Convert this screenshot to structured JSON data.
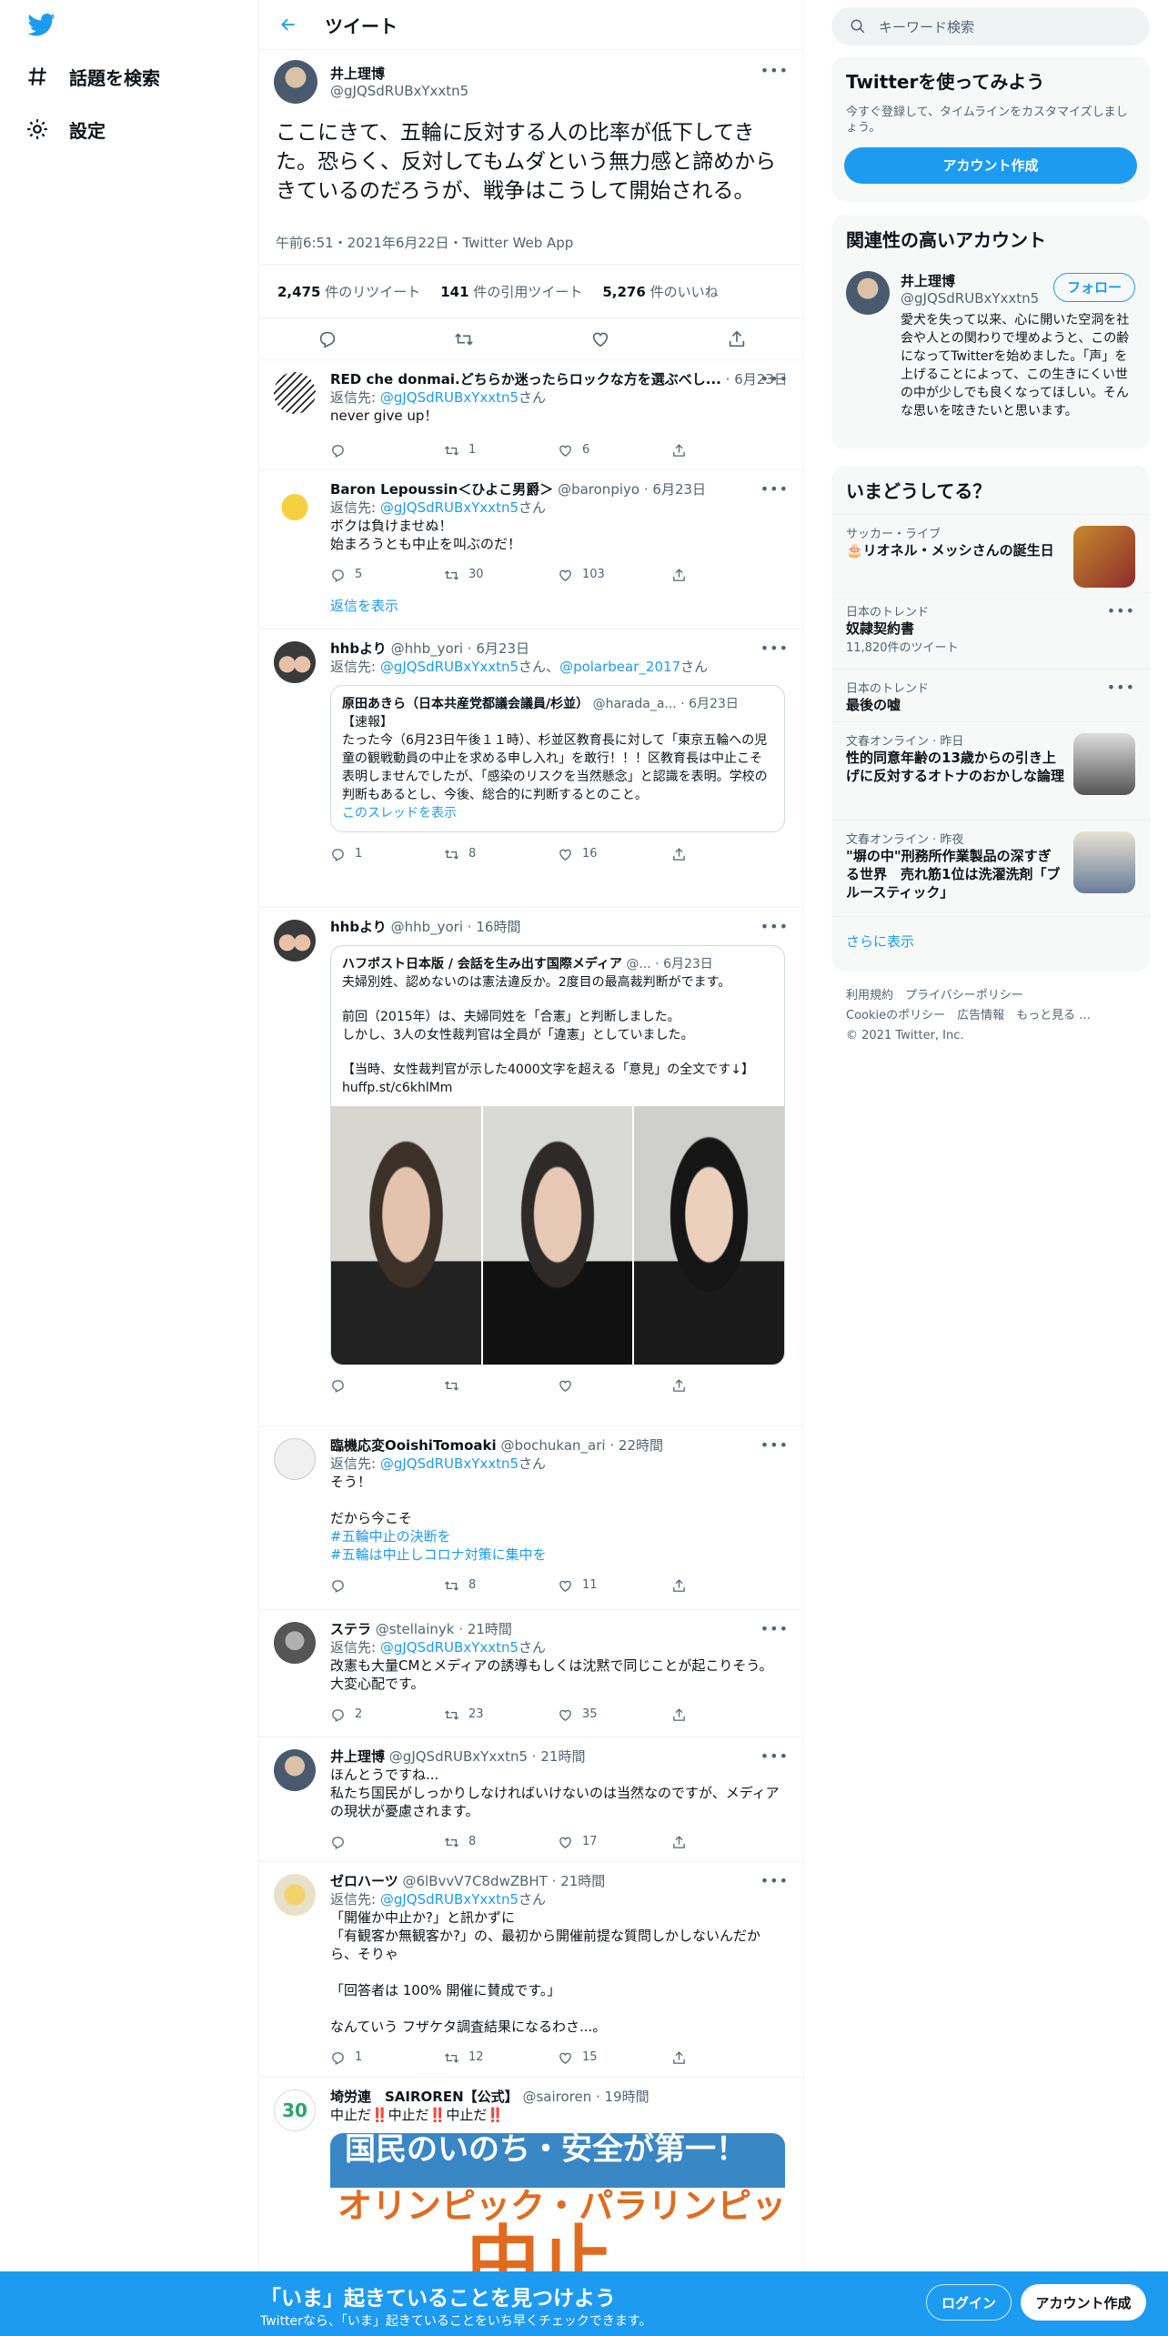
{
  "nav": {
    "explore": "話題を検索",
    "settings": "設定"
  },
  "header": {
    "title": "ツイート"
  },
  "main_tweet": {
    "name": "井上理博",
    "handle": "@gJQSdRUBxYxxtn5",
    "text": "ここにきて、五輪に反対する人の比率が低下してきた。恐らく、反対してもムダという無力感と諦めからきているのだろうが、戦争はこうして開始される。",
    "meta": "午前6:51・2021年6月22日・Twitter Web App",
    "retweets": "2,475",
    "retweets_label": "件のリツイート",
    "quotes": "141",
    "quotes_label": "件の引用ツイート",
    "likes": "5,276",
    "likes_label": "件のいいね"
  },
  "replies": [
    {
      "name": "RED che donmai.どちらか迷ったらロックな方を選ぶべし...",
      "handle": "",
      "time": "6月23日",
      "reply_to_label": "返信先: ",
      "reply_to": "@gJQSdRUBxYxxtn5",
      "reply_suffix": "さん",
      "text": "never give up！",
      "reply_count": "",
      "rt_count": "1",
      "like_count": "6"
    },
    {
      "name": "Baron Lepoussin＜ひよこ男爵＞",
      "handle": "@baronpiyo",
      "time": "6月23日",
      "reply_to_label": "返信先: ",
      "reply_to": "@gJQSdRUBxYxxtn5",
      "reply_suffix": "さん",
      "text1": "ボクは負けませぬ！",
      "text2": "始まろうとも中止を叫ぶのだ！",
      "reply_count": "5",
      "rt_count": "30",
      "like_count": "103",
      "show_replies": "返信を表示"
    },
    {
      "name": "hhbより",
      "handle": "@hhb_yori",
      "time": "6月23日",
      "reply_to_label": "返信先: ",
      "reply_to": "@gJQSdRUBxYxxtn5",
      "reply_mid": "さん、",
      "reply_to2": "@polarbear_2017",
      "reply_suffix": "さん",
      "quote": {
        "name": "原田あきら（日本共産党都議会議員/杉並）",
        "handle": "@harada_a...",
        "time": "6月23日",
        "line1": "【速報】",
        "text": "たった今（6月23日午後１１時）、杉並区教育長に対して「東京五輪への児童の観戦動員の中止を求める申し入れ」を敢行！！！区教育長は中止こそ表明しませんでしたが、「感染のリスクを当然懸念」と認識を表明。学校の判断もあるとし、今後、総合的に判断するとのこと。",
        "link": "このスレッドを表示"
      },
      "reply_count": "1",
      "rt_count": "8",
      "like_count": "16"
    },
    {
      "name": "hhbより",
      "handle": "@hhb_yori",
      "time": "16時間",
      "quote": {
        "name": "ハフポスト日本版 / 会話を生み出す国際メディア",
        "handle": "@...",
        "time": "6月23日",
        "l1": "夫婦別姓、認めないのは憲法違反か。2度目の最高裁判断がでます。",
        "l2": "前回（2015年）は、夫婦同姓を「合憲」と判断しました。",
        "l3": "しかし、3人の女性裁判官は全員が「違憲」としていました。",
        "l4": "【当時、女性裁判官が示した4000文字を超える「意見」の全文です↓】",
        "l5": "huffp.st/c6khlMm"
      },
      "reply_count": "",
      "rt_count": "",
      "like_count": ""
    },
    {
      "name": "臨機応変OoishiTomoaki",
      "handle": "@bochukan_ari",
      "time": "22時間",
      "reply_to_label": "返信先: ",
      "reply_to": "@gJQSdRUBxYxxtn5",
      "reply_suffix": "さん",
      "text1": "そう！",
      "text2": "だから今こそ",
      "tag1": "#五輪中止の決断を",
      "tag2": "#五輪は中止しコロナ対策に集中を",
      "reply_count": "",
      "rt_count": "8",
      "like_count": "11"
    },
    {
      "name": "ステラ",
      "handle": "@stellainyk",
      "time": "21時間",
      "reply_to_label": "返信先: ",
      "reply_to": "@gJQSdRUBxYxxtn5",
      "reply_suffix": "さん",
      "text": "改憲も大量CMとメディアの誘導もしくは沈黙で同じことが起こりそう。大変心配です。",
      "reply_count": "2",
      "rt_count": "23",
      "like_count": "35"
    },
    {
      "name": "井上理博",
      "handle": "@gJQSdRUBxYxxtn5",
      "time": "21時間",
      "text1": "ほんとうですね...",
      "text2": "私たち国民がしっかりしなければいけないのは当然なのですが、メディアの現状が憂慮されます。",
      "reply_count": "",
      "rt_count": "8",
      "like_count": "17"
    },
    {
      "name": "ゼロハーツ",
      "handle": "@6lBvvV7C8dwZBHT",
      "time": "21時間",
      "reply_to_label": "返信先: ",
      "reply_to": "@gJQSdRUBxYxxtn5",
      "reply_suffix": "さん",
      "t1": "「開催か中止か?」と訊かずに",
      "t2": "「有観客か無観客か?」の、最初から開催前提な質問しかしないんだから、そりゃ",
      "t3": "「回答者は 100% 開催に賛成です。」",
      "t4": "なんていう フザケタ調査結果になるわさ...。",
      "reply_count": "1",
      "rt_count": "12",
      "like_count": "15"
    },
    {
      "name": "埼労連　SAIROREN【公式】",
      "handle": "@sairoren",
      "time": "19時間",
      "text": "中止だ‼️中止だ‼️中止だ‼️",
      "banner1": "国民のいのち・安全が第一！",
      "banner2": "オリンピック・パラリンピック",
      "banner3": "中止"
    }
  ],
  "sidebar": {
    "search_placeholder": "キーワード検索",
    "signup": {
      "title": "Twitterを使ってみよう",
      "sub": "今すぐ登録して、タイムラインをカスタマイズしましょう。",
      "button": "アカウント作成"
    },
    "related": {
      "title": "関連性の高いアカウント",
      "name": "井上理博",
      "handle": "@gJQSdRUBxYxxtn5",
      "follow": "フォロー",
      "bio": "愛犬を失って以来、心に開いた空洞を社会や人との関わりで埋めようと、この齢になってTwitterを始めました。「声」を上げることによって、この生きにくい世の中が少しでも良くなってほしい。そんな思いを呟きたいと思います。"
    },
    "trends": {
      "title": "いまどうしてる？",
      "items": [
        {
          "sub": "サッカー・ライブ",
          "main": "🎂リオネル・メッシさんの誕生日"
        },
        {
          "sub": "日本のトレンド",
          "main": "奴隷契約書",
          "count": "11,820件のツイート"
        },
        {
          "sub": "日本のトレンド",
          "main": "最後の嘘"
        },
        {
          "sub": "文春オンライン",
          "time": "昨日",
          "main": "性的同意年齢の13歳からの引き上げに反対するオトナのおかしな論理"
        },
        {
          "sub": "文春オンライン",
          "time": "昨夜",
          "main": "\"塀の中\"刑務所作業製品の深すぎる世界　売れ筋1位は洗濯洗剤「ブルースティック」"
        }
      ],
      "more": "さらに表示"
    },
    "footer": {
      "l1": "利用規約",
      "l2": "プライバシーポリシー",
      "l3": "Cookieのポリシー",
      "l4": "広告情報",
      "l5": "もっと見る ...",
      "copy": "© 2021 Twitter, Inc."
    }
  },
  "bottom_bar": {
    "title": "「いま」起きていることを見つけよう",
    "sub": "Twitterなら、「いま」起きていることをいち早くチェックできます。",
    "login": "ログイン",
    "signup": "アカウント作成"
  },
  "colors": {
    "accent": "#1d9bf0",
    "text": "#0f1419",
    "secondary": "#536471",
    "border": "#eff3f4"
  }
}
